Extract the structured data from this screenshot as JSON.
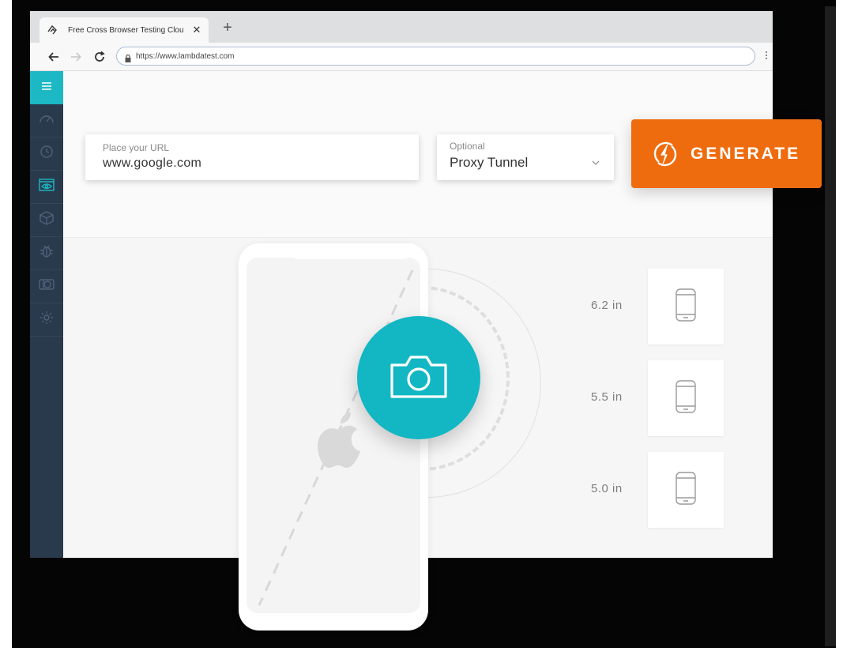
{
  "browser": {
    "tab_title": "Free Cross Browser Testing Clou",
    "new_tab_symbol": "+",
    "close_symbol": "✕",
    "url": "https://www.lambdatest.com"
  },
  "sidebar": {
    "items": [
      {
        "icon": "menu-icon"
      },
      {
        "icon": "speedometer-icon"
      },
      {
        "icon": "history-clock-icon"
      },
      {
        "icon": "screenshot-eye-icon",
        "active": true
      },
      {
        "icon": "box-icon"
      },
      {
        "icon": "bug-icon"
      },
      {
        "icon": "compare-icon"
      },
      {
        "icon": "gear-icon"
      }
    ]
  },
  "form": {
    "url_label": "Place your URL",
    "url_value": "www.google.com",
    "proxy_label": "Optional",
    "proxy_value": "Proxy Tunnel"
  },
  "generate": {
    "label": "GENERATE"
  },
  "devices": [
    {
      "size": "6.2 in"
    },
    {
      "size": "5.5 in"
    },
    {
      "size": "5.0 in"
    }
  ],
  "colors": {
    "accent_teal": "#12b7c3",
    "generate_orange": "#ef6c0e",
    "sidebar_bg": "#2a3a4d"
  }
}
